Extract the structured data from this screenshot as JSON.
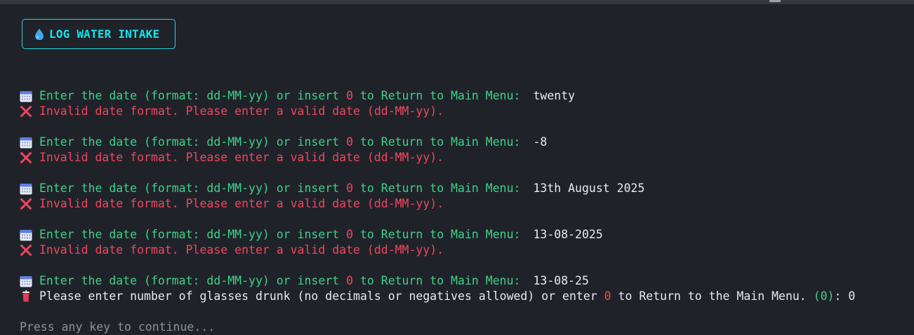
{
  "header": {
    "title": "LOG WATER INTAKE"
  },
  "prompts": [
    {
      "prompt_pre": "Enter the date (format: dd-MM-yy) or insert ",
      "zero": "0",
      "prompt_post": " to Return to Main Menu:",
      "answer": "twenty",
      "error": "Invalid date format. Please enter a valid date (dd-MM-yy)."
    },
    {
      "prompt_pre": "Enter the date (format: dd-MM-yy) or insert ",
      "zero": "0",
      "prompt_post": " to Return to Main Menu:",
      "answer": "-8",
      "error": "Invalid date format. Please enter a valid date (dd-MM-yy)."
    },
    {
      "prompt_pre": "Enter the date (format: dd-MM-yy) or insert ",
      "zero": "0",
      "prompt_post": " to Return to Main Menu:",
      "answer": "13th August 2025",
      "error": "Invalid date format. Please enter a valid date (dd-MM-yy)."
    },
    {
      "prompt_pre": "Enter the date (format: dd-MM-yy) or insert ",
      "zero": "0",
      "prompt_post": " to Return to Main Menu:",
      "answer": "13-08-2025",
      "error": "Invalid date format. Please enter a valid date (dd-MM-yy)."
    },
    {
      "prompt_pre": "Enter the date (format: dd-MM-yy) or insert ",
      "zero": "0",
      "prompt_post": " to Return to Main Menu:",
      "answer": "13-08-25"
    }
  ],
  "glasses_prompt": {
    "pre": "Please enter number of glasses drunk (no decimals or negatives allowed) or enter ",
    "zero": "0",
    "post": " to Return to the Main Menu. ",
    "default": "(0)",
    "colon": ": ",
    "answer": "0"
  },
  "footer": {
    "continue_text": "Press any key to continue..."
  },
  "colors": {
    "background": "#1f2329",
    "accent_cyan": "#16e3f0",
    "prompt_green": "#3fd08a",
    "error_red": "#f0465f",
    "input_white": "#e6ebf0",
    "muted_gray": "#8c939b"
  },
  "icons": {
    "header": "water-drop-icon",
    "prompt": "calendar-icon",
    "error": "cross-mark-icon",
    "glasses": "cup-icon"
  }
}
